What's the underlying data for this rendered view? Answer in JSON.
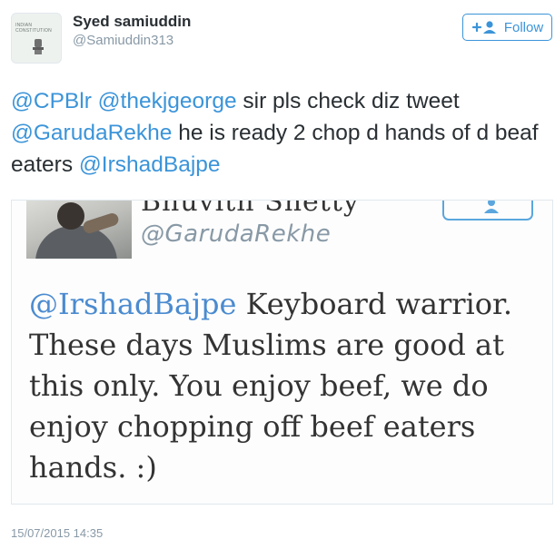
{
  "author": {
    "name": "Syed samiuddin",
    "handle": "@Samiuddin313",
    "avatar_caption": "INDIAN CONSTITUTION"
  },
  "follow_button": {
    "label": "Follow",
    "icon": "add-user-icon",
    "color": "#3b94d9"
  },
  "tweet": {
    "segments": [
      {
        "text": "@CPBlr",
        "mention": true
      },
      {
        "text": " ",
        "mention": false
      },
      {
        "text": "@thekjgeorge",
        "mention": true
      },
      {
        "text": " sir pls check diz tweet ",
        "mention": false
      },
      {
        "text": "@GarudaRekhe",
        "mention": true
      },
      {
        "text": " he is ready 2 chop d hands of d beaf eaters ",
        "mention": false
      },
      {
        "text": "@IrshadBajpe",
        "mention": true
      }
    ]
  },
  "embedded_screenshot": {
    "name_partial": "Bhuvith Shetty",
    "handle": "@GarudaRekhe",
    "mention": "@IrshadBajpe",
    "text": " Keyboard warrior. These days Muslims are good at this only. You enjoy beef, we do enjoy chopping off beef eaters hands. :)"
  },
  "timestamp": "15/07/2015 14:35",
  "colors": {
    "link": "#3b94d9",
    "text": "#292f33",
    "muted": "#8899a6"
  }
}
